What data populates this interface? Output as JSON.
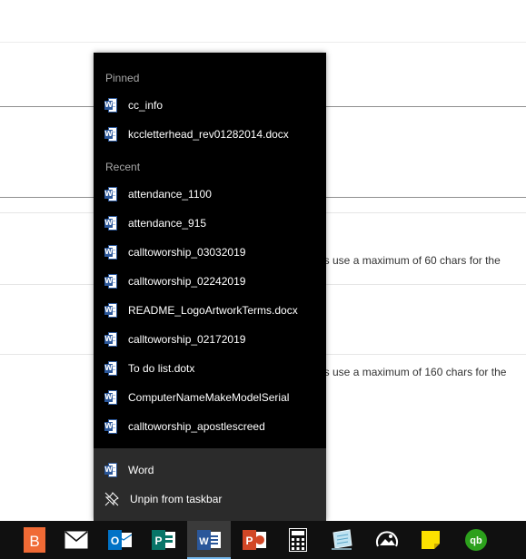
{
  "background": {
    "snippet_1": "es use a maximum of 60 chars for the",
    "snippet_2": "es use a maximum of 160 chars for the"
  },
  "jumplist": {
    "pinned_header": "Pinned",
    "pinned": [
      {
        "label": "cc_info"
      },
      {
        "label": "kccletterhead_rev01282014.docx"
      }
    ],
    "recent_header": "Recent",
    "recent": [
      {
        "label": "attendance_1100"
      },
      {
        "label": "attendance_915"
      },
      {
        "label": "calltoworship_03032019"
      },
      {
        "label": "calltoworship_02242019"
      },
      {
        "label": "README_LogoArtworkTerms.docx"
      },
      {
        "label": "calltoworship_02172019"
      },
      {
        "label": "To do list.dotx"
      },
      {
        "label": "ComputerNameMakeModelSerial"
      },
      {
        "label": "calltoworship_apostlescreed"
      }
    ],
    "tasks": {
      "app_label": "Word",
      "unpin_label": "Unpin from taskbar"
    }
  },
  "taskbar": {
    "icons": [
      {
        "name": "blogger-icon",
        "glyph": "B"
      },
      {
        "name": "mail-icon"
      },
      {
        "name": "outlook-icon",
        "glyph": "O"
      },
      {
        "name": "publisher-icon",
        "glyph": "P"
      },
      {
        "name": "word-icon",
        "glyph": "W",
        "active": true
      },
      {
        "name": "powerpoint-icon",
        "glyph": "P"
      },
      {
        "name": "calculator-icon"
      },
      {
        "name": "notepad-icon"
      },
      {
        "name": "photos-icon"
      },
      {
        "name": "sticky-notes-icon"
      },
      {
        "name": "quickbooks-icon",
        "glyph": "qb"
      }
    ]
  },
  "colors": {
    "jumplist_bg": "#000000",
    "jumplist_tasks_bg": "#2b2b2b",
    "header_text": "#a8a8a8",
    "taskbar_bg": "#101010",
    "word_blue": "#2b579a",
    "accent": "#76b9ed"
  }
}
